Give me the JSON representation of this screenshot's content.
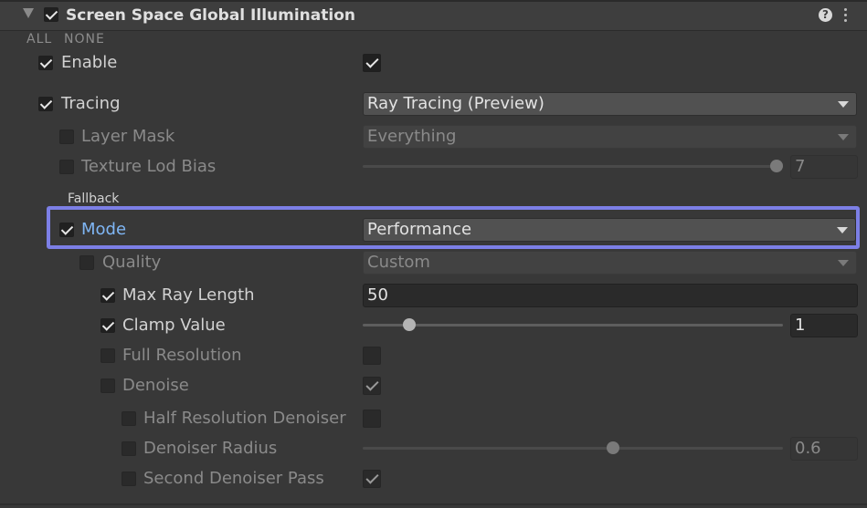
{
  "header": {
    "title": "Screen Space Global Illumination",
    "help_glyph": "?",
    "all_label": "ALL",
    "none_label": "NONE"
  },
  "rows": {
    "enable": {
      "label": "Enable",
      "override": true,
      "value": true
    },
    "tracing": {
      "label": "Tracing",
      "override": true,
      "value": "Ray Tracing (Preview)"
    },
    "layer_mask": {
      "label": "Layer Mask",
      "override": false,
      "value": "Everything"
    },
    "texture_lod_bias": {
      "label": "Texture Lod Bias",
      "override": false,
      "value": "7",
      "slider_fraction": 1.0
    },
    "fallback_heading": "Fallback",
    "mode": {
      "label": "Mode",
      "override": true,
      "value": "Performance"
    },
    "quality": {
      "label": "Quality",
      "override": false,
      "value": "Custom"
    },
    "max_ray_length": {
      "label": "Max Ray Length",
      "override": true,
      "value": "50"
    },
    "clamp_value": {
      "label": "Clamp Value",
      "override": true,
      "value": "1",
      "slider_fraction": 0.11
    },
    "full_resolution": {
      "label": "Full Resolution",
      "override": false,
      "value": false
    },
    "denoise": {
      "label": "Denoise",
      "override": false,
      "value": true
    },
    "half_resolution_denoiser": {
      "label": "Half Resolution Denoiser",
      "override": false,
      "value": false
    },
    "denoiser_radius": {
      "label": "Denoiser Radius",
      "override": false,
      "value": "0.6",
      "slider_fraction": 0.59
    },
    "second_denoiser_pass": {
      "label": "Second Denoiser Pass",
      "override": false,
      "value": true
    }
  },
  "colors": {
    "highlight_border": "#7c7fe6",
    "mode_label": "#7fb6f5",
    "background": "#383838"
  }
}
